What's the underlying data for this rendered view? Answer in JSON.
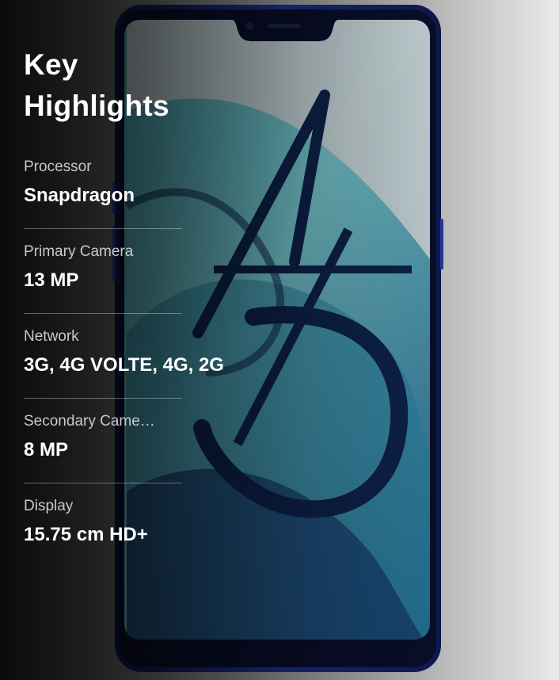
{
  "section": {
    "title": "Key Highlights"
  },
  "specs": [
    {
      "label": "Processor",
      "value": "Snapdragon"
    },
    {
      "label": "Primary Camera",
      "value": "13 MP"
    },
    {
      "label": "Network",
      "value": "3G, 4G VOLTE, 4G, 2G"
    },
    {
      "label": "Secondary Came…",
      "value": "8 MP"
    },
    {
      "label": "Display",
      "value": "15.75 cm HD+"
    }
  ],
  "colors": {
    "phone_frame": "#1a2a7a",
    "wallpaper_light": "#5fc9d6",
    "wallpaper_dark": "#0f2a52",
    "text_primary": "#ffffff",
    "text_secondary": "#c9c9c9"
  }
}
